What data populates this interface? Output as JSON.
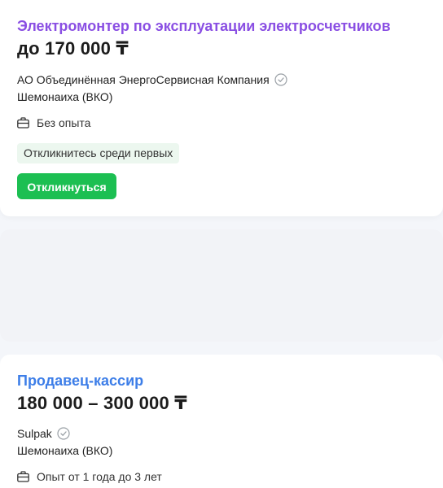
{
  "vacancies": [
    {
      "title": "Электромонтер по эксплуатации электросчетчиков",
      "title_color": "#8a4fe3",
      "salary": "до 170 000 ₸",
      "company": "АО Объединённая ЭнергоСервисная Компания",
      "verified_icon": "check-circle-icon",
      "location": "Шемонаиха (ВКО)",
      "experience_icon": "briefcase-icon",
      "experience": "Без опыта",
      "badge": "Откликнитесь среди первых",
      "respond_label": "Откликнуться"
    },
    {
      "title": "Продавец-кассир",
      "title_color": "#3d7ee8",
      "salary": "180 000 – 300 000 ₸",
      "company": "Sulpak",
      "verified_icon": "check-circle-icon",
      "location": "Шемонаиха (ВКО)",
      "experience_icon": "briefcase-icon",
      "experience": "Опыт от 1 года до 3 лет"
    }
  ],
  "colors": {
    "respond_button": "#1cbf52",
    "badge_bg": "#ecf7ef"
  }
}
